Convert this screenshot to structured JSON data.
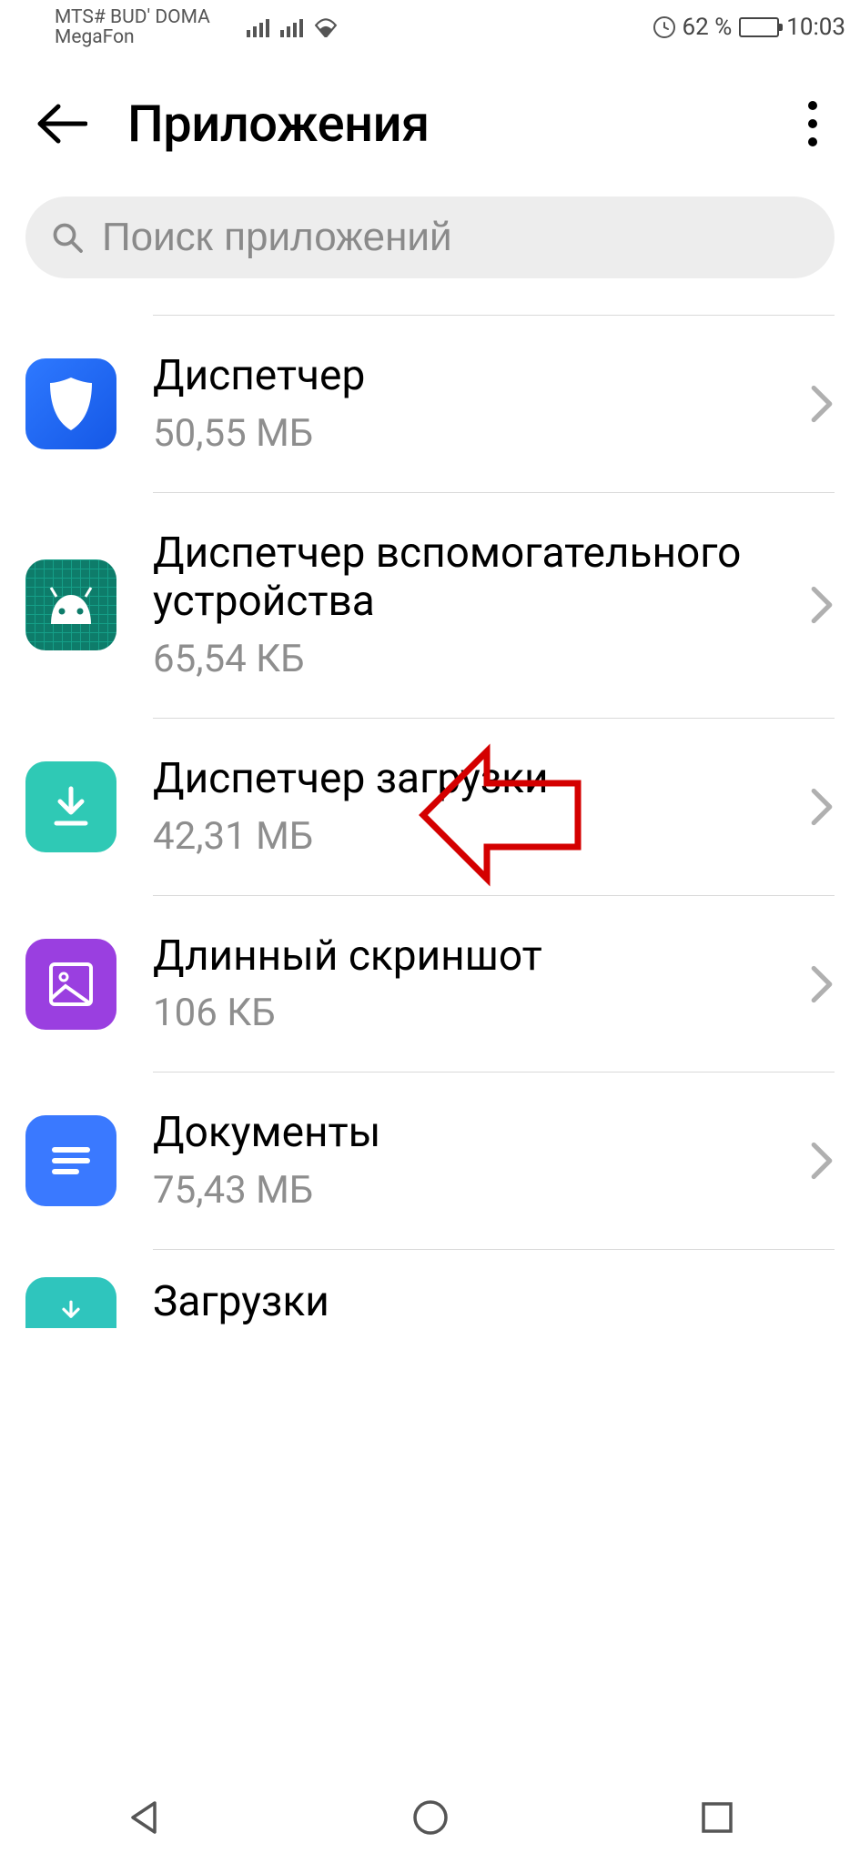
{
  "status": {
    "carrier1": "MTS# BUD' DOMA",
    "carrier2": "MegaFon",
    "battery_text": "62 %",
    "time": "10:03"
  },
  "header": {
    "title": "Приложения"
  },
  "search": {
    "placeholder": "Поиск приложений"
  },
  "apps": [
    {
      "name": "Диспетчер",
      "size": "50,55 МБ",
      "icon": "shield"
    },
    {
      "name": "Диспетчер вспомогательного устройства",
      "size": "65,54 КБ",
      "icon": "android"
    },
    {
      "name": "Диспетчер загрузки",
      "size": "42,31 МБ",
      "icon": "download"
    },
    {
      "name": "Длинный скриншот",
      "size": "106 КБ",
      "icon": "scroll"
    },
    {
      "name": "Документы",
      "size": "75,43 МБ",
      "icon": "docs"
    },
    {
      "name": "Загрузки",
      "size": "",
      "icon": "downloads2"
    }
  ],
  "annotation": {
    "target_index": 2,
    "color": "#d40000"
  }
}
